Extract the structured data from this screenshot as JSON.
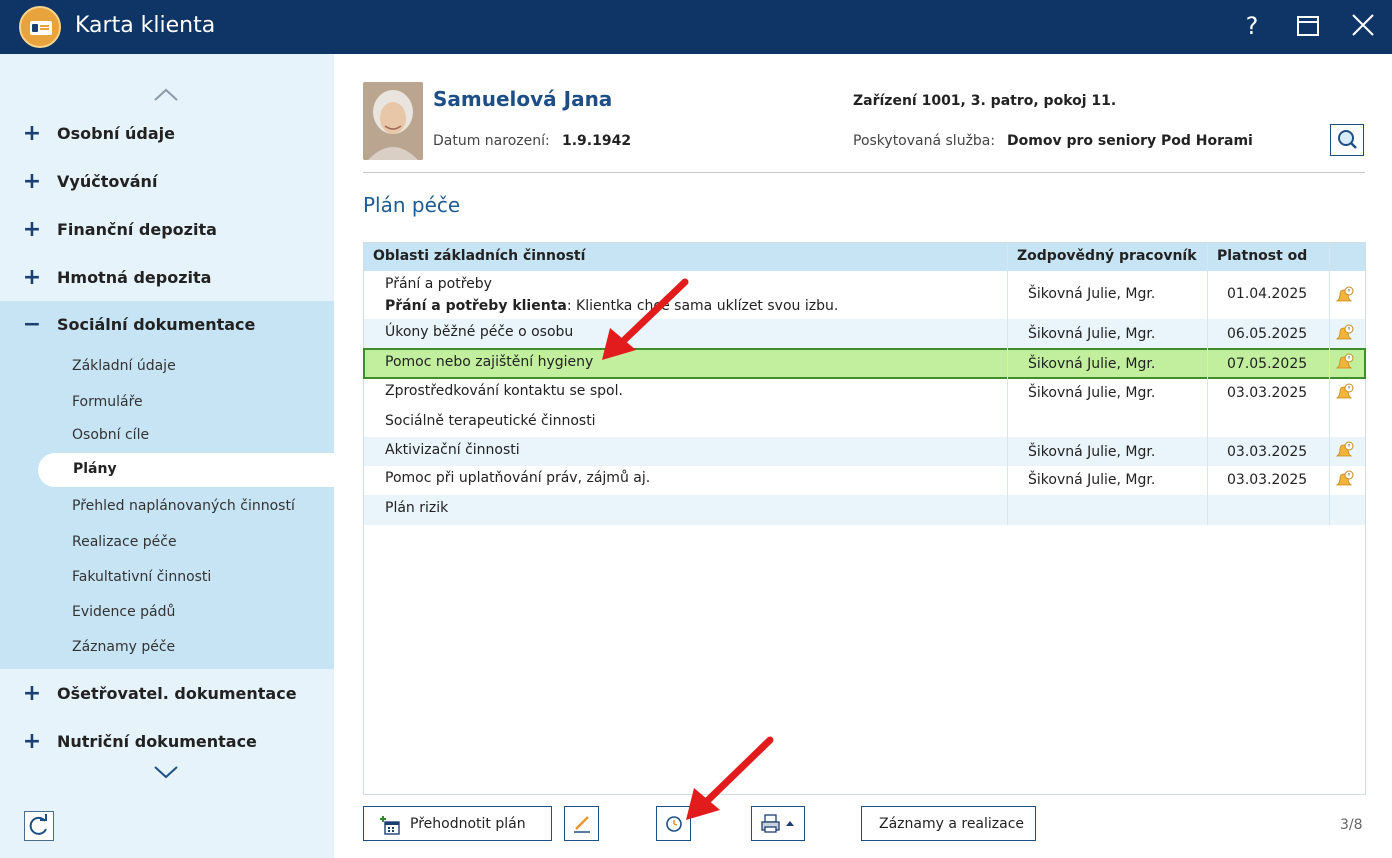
{
  "window": {
    "title": "Karta klienta",
    "help_glyph": "?",
    "maximize_glyph": "□",
    "close_glyph": "✕"
  },
  "sidebar": {
    "items": [
      {
        "label": "Osobní údaje",
        "expander": "+"
      },
      {
        "label": "Vyúčtování",
        "expander": "+"
      },
      {
        "label": "Finanční depozita",
        "expander": "+"
      },
      {
        "label": "Hmotná depozita",
        "expander": "+"
      },
      {
        "label": "Sociální dokumentace",
        "expander": "−"
      },
      {
        "label": "Ošetřovatel. dokumentace",
        "expander": "+"
      },
      {
        "label": "Nutriční dokumentace",
        "expander": "+"
      }
    ],
    "subitems": [
      "Základní údaje",
      "Formuláře",
      "Osobní cíle",
      "Plány",
      "Přehled naplánovaných činností",
      "Realizace péče",
      "Fakultativní činnosti",
      "Evidence pádů",
      "Záznamy péče"
    ],
    "active_subitem": "Plány"
  },
  "client": {
    "name": "Samuelová Jana",
    "dob_label": "Datum narození:",
    "dob": "1.9.1942",
    "facility": "Zařízení 1001, 3. patro, pokoj 11.",
    "service_label": "Poskytovaná služba:",
    "service": "Domov pro seniory Pod Horami"
  },
  "section_title": "Plán péče",
  "table": {
    "columns": [
      "Oblasti základních činností",
      "Zodpovědný pracovník",
      "Platnost od"
    ],
    "rows": [
      {
        "area": "Přání a potřeby",
        "detail_bold": "Přání a potřeby klienta",
        "detail_text": ": Klientka chce sama uklízet svou izbu.",
        "worker": "Šikovná Julie, Mgr.",
        "date": "01.04.2025",
        "bell": true
      },
      {
        "area": "Úkony běžné péče o osobu",
        "worker": "Šikovná Julie, Mgr.",
        "date": "06.05.2025",
        "bell": true
      },
      {
        "area": "Pomoc nebo zajištění hygieny",
        "worker": "Šikovná Julie, Mgr.",
        "date": "07.05.2025",
        "bell": true,
        "selected": true
      },
      {
        "area": "Zprostředkování kontaktu se spol.",
        "worker": "Šikovná Julie, Mgr.",
        "date": "03.03.2025",
        "bell": true
      },
      {
        "area": "Sociálně terapeutické činnosti",
        "worker": "",
        "date": "",
        "bell": false
      },
      {
        "area": "Aktivizační činnosti",
        "worker": "Šikovná Julie, Mgr.",
        "date": "03.03.2025",
        "bell": true
      },
      {
        "area": "Pomoc při uplatňování práv, zájmů aj.",
        "worker": "Šikovná Julie, Mgr.",
        "date": "03.03.2025",
        "bell": true
      },
      {
        "area": "Plán rizik",
        "worker": "",
        "date": "",
        "bell": false
      }
    ]
  },
  "footer": {
    "reevaluate_label": "Přehodnotit plán",
    "records_label": "Záznamy a realizace",
    "pager": "3/8"
  },
  "colors": {
    "titlebar": "#0e3566",
    "sidebar": "#e6f3fb",
    "sidebar_section": "#c7e4f4",
    "selected_row": "#c2ef9e",
    "accent": "#1d4f86",
    "annotation_arrow": "#e21c1c"
  }
}
